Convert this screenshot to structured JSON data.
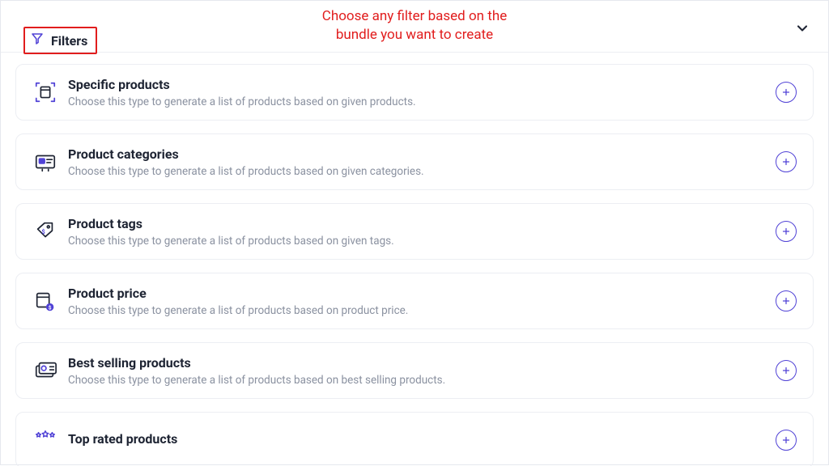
{
  "header": {
    "filters_label": "Filters",
    "hint_line1": "Choose any filter based on the",
    "hint_line2": "bundle you want to create"
  },
  "filters": [
    {
      "icon": "specific-products-icon",
      "title": "Specific products",
      "desc": "Choose this type to generate a list of products based on given products."
    },
    {
      "icon": "product-categories-icon",
      "title": "Product categories",
      "desc": "Choose this type to generate a list of products based on given categories."
    },
    {
      "icon": "product-tags-icon",
      "title": "Product tags",
      "desc": "Choose this type to generate a list of products based on given tags."
    },
    {
      "icon": "product-price-icon",
      "title": "Product price",
      "desc": "Choose this type to generate a list of products based on product price."
    },
    {
      "icon": "best-selling-icon",
      "title": "Best selling products",
      "desc": "Choose this type to generate a list of products based on best selling products."
    },
    {
      "icon": "top-rated-icon",
      "title": "Top rated products",
      "desc": ""
    }
  ]
}
